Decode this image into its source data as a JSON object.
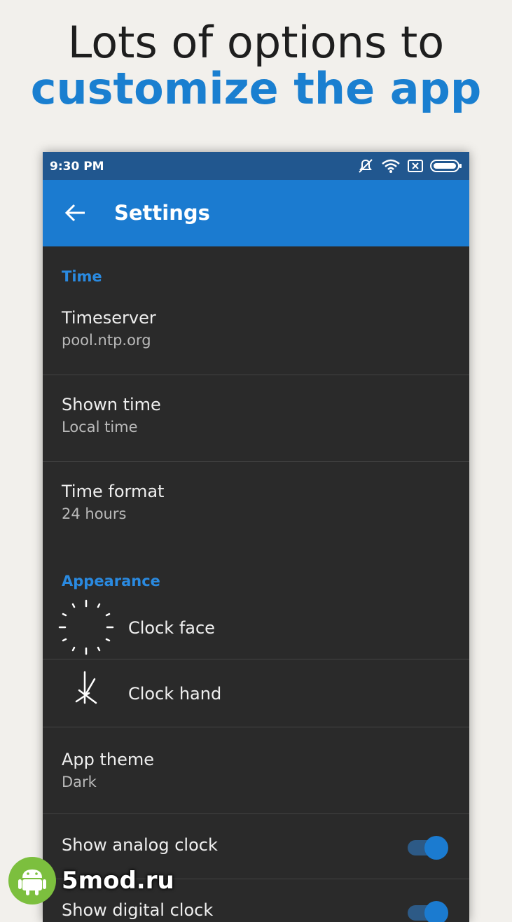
{
  "promo": {
    "line1": "Lots of options to",
    "line2": "customize the app"
  },
  "statusbar": {
    "time": "9:30 PM",
    "icons": [
      "mute-icon",
      "wifi-icon",
      "sim-off-icon",
      "battery-icon"
    ]
  },
  "appbar": {
    "title": "Settings",
    "back_icon": "arrow-left-icon"
  },
  "sections": {
    "time": {
      "header": "Time",
      "timeserver": {
        "title": "Timeserver",
        "summary": "pool.ntp.org"
      },
      "shown_time": {
        "title": "Shown time",
        "summary": "Local time"
      },
      "time_format": {
        "title": "Time format",
        "summary": "24 hours"
      }
    },
    "appearance": {
      "header": "Appearance",
      "clock_face": {
        "title": "Clock face",
        "icon": "clock-face-icon"
      },
      "clock_hand": {
        "title": "Clock hand",
        "icon": "clock-hand-icon"
      },
      "app_theme": {
        "title": "App theme",
        "summary": "Dark"
      },
      "show_analog": {
        "title": "Show analog clock",
        "enabled": true
      },
      "show_digital": {
        "title": "Show digital clock",
        "enabled": true
      }
    }
  },
  "watermark": {
    "text": "5mod.ru",
    "icon": "android-icon"
  },
  "colors": {
    "accent": "#1b7bd0",
    "statusbar": "#21578f",
    "background": "#2a2a2a",
    "category": "#2a8ae0"
  }
}
